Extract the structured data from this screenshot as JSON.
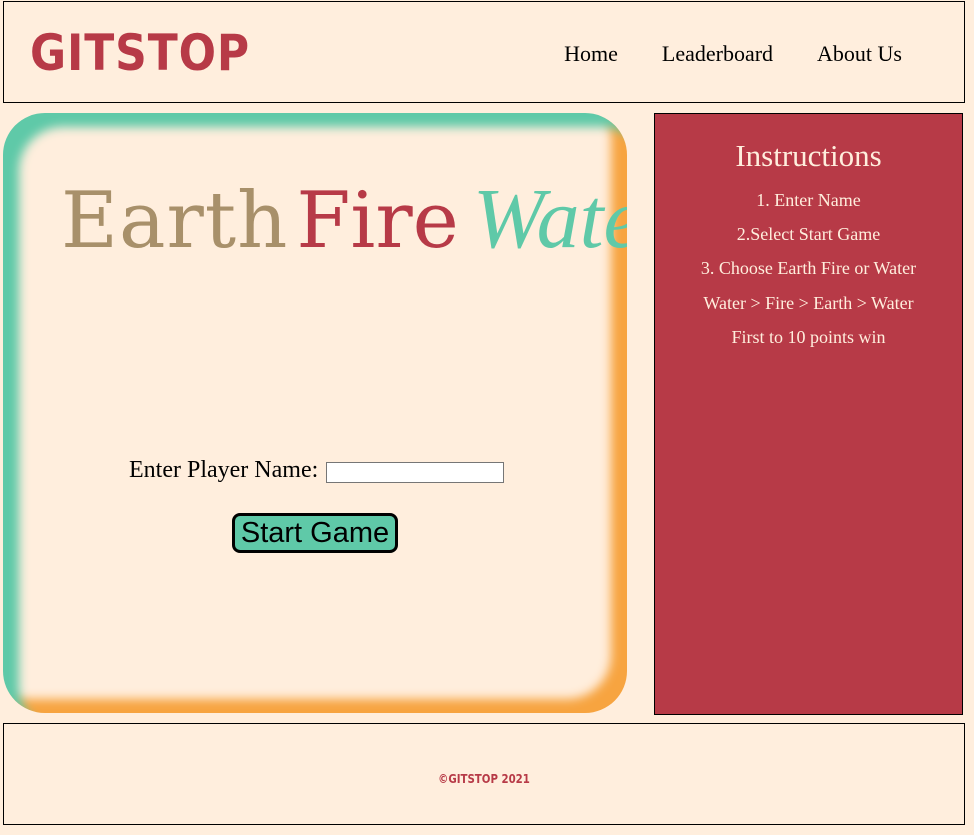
{
  "header": {
    "logo": "GITSTOP",
    "nav": [
      "Home",
      "Leaderboard",
      "About Us"
    ]
  },
  "game": {
    "title": {
      "earth": "Earth",
      "fire": "Fire",
      "water": "Water"
    },
    "player_label": "Enter Player Name:",
    "player_value": "",
    "start_label": "Start Game"
  },
  "instructions": {
    "title": "Instructions",
    "steps": [
      "1. Enter Name",
      "2.Select Start Game",
      "3. Choose Earth Fire or Water",
      "Water > Fire > Earth > Water",
      "First to 10 points win"
    ]
  },
  "footer": {
    "copyright": "©GITSTOP 2021"
  },
  "colors": {
    "background": "#ffeedd",
    "brand_red": "#b73a47",
    "teal": "#5fc9a8",
    "orange": "#f7a440",
    "earth_tan": "#a8906a"
  }
}
